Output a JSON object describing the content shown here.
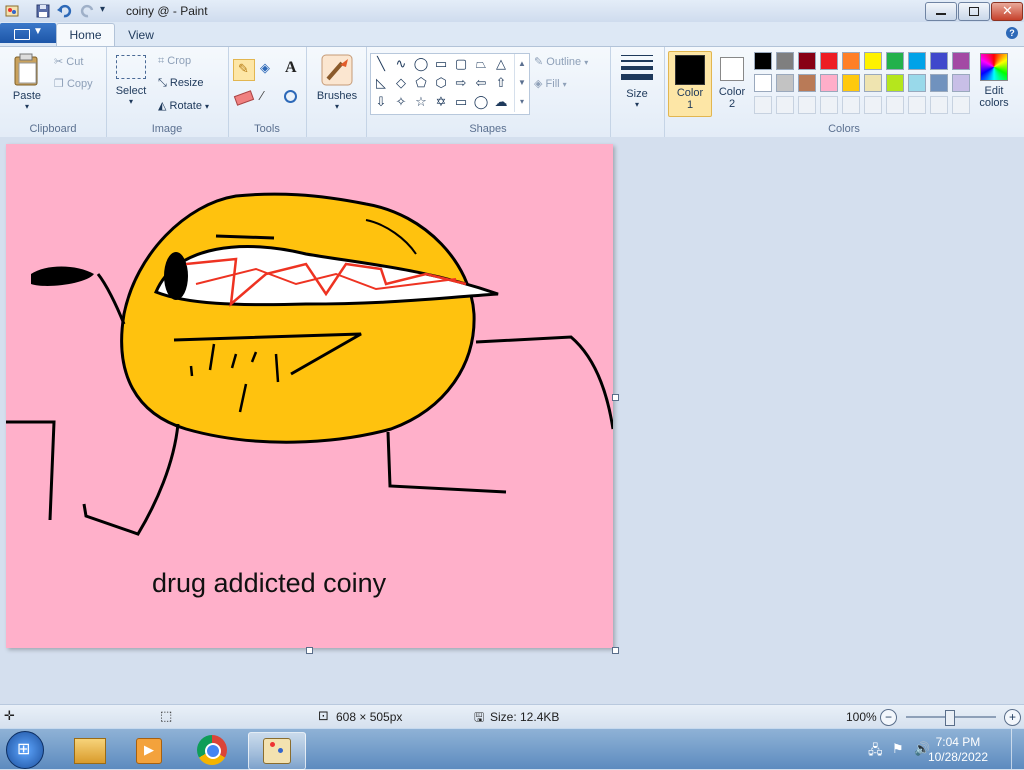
{
  "window": {
    "title": "coiny @ - Paint"
  },
  "tabs": [
    {
      "label": "Home"
    },
    {
      "label": "View"
    }
  ],
  "clipboard": {
    "paste": "Paste",
    "cut": "Cut",
    "copy": "Copy",
    "group": "Clipboard"
  },
  "image": {
    "select": "Select",
    "crop": "Crop",
    "resize": "Resize",
    "rotate": "Rotate",
    "group": "Image"
  },
  "tools": {
    "group": "Tools"
  },
  "brushes": {
    "label": "Brushes"
  },
  "shapes": {
    "outline": "Outline",
    "fill": "Fill",
    "group": "Shapes"
  },
  "size": {
    "label": "Size"
  },
  "colors": {
    "color1": "Color\n1",
    "color1_l1": "Color",
    "color1_l2": "1",
    "color2_l1": "Color",
    "color2_l2": "2",
    "edit_l1": "Edit",
    "edit_l2": "colors",
    "group": "Colors",
    "color1_value": "#000000",
    "color2_value": "#ffffff",
    "palette_row1": [
      "#000000",
      "#7f7f7f",
      "#880015",
      "#ed1c24",
      "#ff7f27",
      "#fff200",
      "#22b14c",
      "#00a2e8",
      "#3f48cc",
      "#a349a4"
    ],
    "palette_row2": [
      "#ffffff",
      "#c3c3c3",
      "#b97a57",
      "#ffaec9",
      "#ffc90e",
      "#efe4b0",
      "#b5e61d",
      "#99d9ea",
      "#7092be",
      "#c8bfe7"
    ]
  },
  "canvas": {
    "background": "#ffb0ca",
    "text": "drug addicted coiny"
  },
  "status": {
    "dimensions": "608 × 505px",
    "size": "Size: 12.4KB",
    "zoom": "100%"
  },
  "taskbar": {
    "time": "7:04 PM",
    "date": "10/28/2022"
  }
}
